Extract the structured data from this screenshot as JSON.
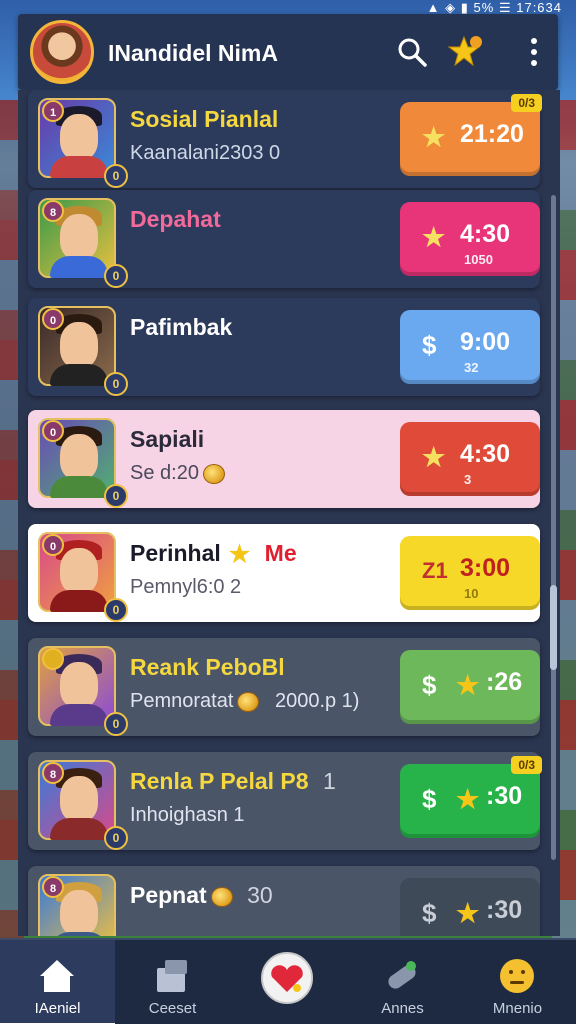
{
  "status_bar": {
    "time": "17:634",
    "battery": "5%"
  },
  "header": {
    "title": "INandidel NimA",
    "icons": [
      "search-icon",
      "star-badge-icon",
      "more-vert-icon"
    ]
  },
  "rows": [
    {
      "rank": "1",
      "level": "0",
      "name": "Sosial Pianlal",
      "subtitle": "Kaanalani2303 0",
      "button_icon": "★",
      "button_time": "21:20",
      "button_sub": "",
      "tag": "0/3",
      "theme": "orange"
    },
    {
      "rank": "8",
      "level": "0",
      "name": "Depahat",
      "subtitle": "",
      "button_icon": "★",
      "button_time": "4:30",
      "button_sub": "1050",
      "tag": "",
      "theme": "pink"
    },
    {
      "rank": "0",
      "level": "0",
      "name": "Pafimbak",
      "subtitle": "",
      "button_icon": "$",
      "button_time": "9:00",
      "button_sub": "32",
      "tag": "",
      "theme": "blue"
    },
    {
      "rank": "0",
      "level": "0",
      "name": "Sapiali",
      "subtitle": "Se d:20",
      "button_icon": "★",
      "button_time": "4:30",
      "button_sub": "3",
      "tag": "",
      "theme": "red"
    },
    {
      "rank": "0",
      "level": "0",
      "name": "Perinhal",
      "name_badge": "Me",
      "subtitle": "Pemnyl6:0 2",
      "button_icon": "Z1",
      "button_time": "3:00",
      "button_sub": "10",
      "tag": "",
      "theme": "yellow"
    },
    {
      "rank": "",
      "level": "0",
      "name": "Reank PeboBl",
      "subtitle": "Pemnoratat",
      "subtitle_value": "2000.p 1)",
      "button_icon": "$",
      "button_time": ":26",
      "button_sub": "",
      "tag": "",
      "theme": "green-light"
    },
    {
      "rank": "8",
      "level": "0",
      "name": "Renla P Pelal P8",
      "name_suffix": "1",
      "subtitle": "Inhoighasn 1",
      "button_icon": "$",
      "button_time": ":30",
      "button_sub": "",
      "tag": "0/3",
      "theme": "green"
    },
    {
      "rank": "8",
      "level": "",
      "name": "Pepnat",
      "name_suffix": "30",
      "subtitle": "",
      "button_icon": "$",
      "button_time": ":30",
      "button_sub": "",
      "tag": "",
      "theme": "dark"
    }
  ],
  "bottom_nav": [
    {
      "label": "IAeniel",
      "icon": "home-icon",
      "active": true
    },
    {
      "label": "Ceeset",
      "icon": "cards-icon",
      "active": false
    },
    {
      "label": "",
      "icon": "heart-icon",
      "active": false
    },
    {
      "label": "Annes",
      "icon": "tag-icon",
      "active": false
    },
    {
      "label": "Mnenio",
      "icon": "emoji-icon",
      "active": false
    }
  ],
  "colors": {
    "orange": "#f08a3a",
    "pink": "#e8357a",
    "blue": "#6aa8f0",
    "red": "#e04a38",
    "yellow": "#f5d828",
    "green-light": "#6cb85a",
    "green": "#27b24a",
    "dark": "#3f4a58"
  }
}
